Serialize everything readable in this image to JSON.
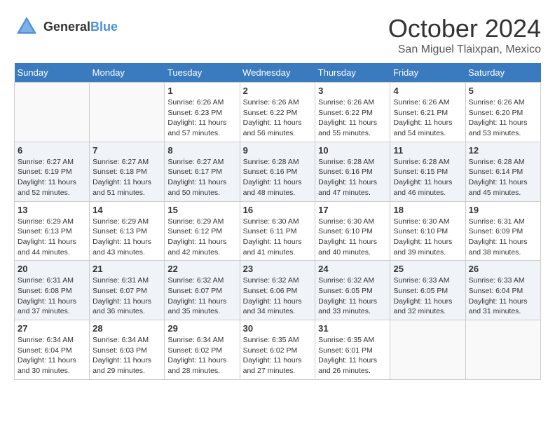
{
  "header": {
    "logo_general": "General",
    "logo_blue": "Blue",
    "month_title": "October 2024",
    "location": "San Miguel Tlaixpan, Mexico"
  },
  "calendar": {
    "days_of_week": [
      "Sunday",
      "Monday",
      "Tuesday",
      "Wednesday",
      "Thursday",
      "Friday",
      "Saturday"
    ],
    "weeks": [
      [
        {
          "day": "",
          "info": ""
        },
        {
          "day": "",
          "info": ""
        },
        {
          "day": "1",
          "info": "Sunrise: 6:26 AM\nSunset: 6:23 PM\nDaylight: 11 hours and 57 minutes."
        },
        {
          "day": "2",
          "info": "Sunrise: 6:26 AM\nSunset: 6:22 PM\nDaylight: 11 hours and 56 minutes."
        },
        {
          "day": "3",
          "info": "Sunrise: 6:26 AM\nSunset: 6:22 PM\nDaylight: 11 hours and 55 minutes."
        },
        {
          "day": "4",
          "info": "Sunrise: 6:26 AM\nSunset: 6:21 PM\nDaylight: 11 hours and 54 minutes."
        },
        {
          "day": "5",
          "info": "Sunrise: 6:26 AM\nSunset: 6:20 PM\nDaylight: 11 hours and 53 minutes."
        }
      ],
      [
        {
          "day": "6",
          "info": "Sunrise: 6:27 AM\nSunset: 6:19 PM\nDaylight: 11 hours and 52 minutes."
        },
        {
          "day": "7",
          "info": "Sunrise: 6:27 AM\nSunset: 6:18 PM\nDaylight: 11 hours and 51 minutes."
        },
        {
          "day": "8",
          "info": "Sunrise: 6:27 AM\nSunset: 6:17 PM\nDaylight: 11 hours and 50 minutes."
        },
        {
          "day": "9",
          "info": "Sunrise: 6:28 AM\nSunset: 6:16 PM\nDaylight: 11 hours and 48 minutes."
        },
        {
          "day": "10",
          "info": "Sunrise: 6:28 AM\nSunset: 6:16 PM\nDaylight: 11 hours and 47 minutes."
        },
        {
          "day": "11",
          "info": "Sunrise: 6:28 AM\nSunset: 6:15 PM\nDaylight: 11 hours and 46 minutes."
        },
        {
          "day": "12",
          "info": "Sunrise: 6:28 AM\nSunset: 6:14 PM\nDaylight: 11 hours and 45 minutes."
        }
      ],
      [
        {
          "day": "13",
          "info": "Sunrise: 6:29 AM\nSunset: 6:13 PM\nDaylight: 11 hours and 44 minutes."
        },
        {
          "day": "14",
          "info": "Sunrise: 6:29 AM\nSunset: 6:13 PM\nDaylight: 11 hours and 43 minutes."
        },
        {
          "day": "15",
          "info": "Sunrise: 6:29 AM\nSunset: 6:12 PM\nDaylight: 11 hours and 42 minutes."
        },
        {
          "day": "16",
          "info": "Sunrise: 6:30 AM\nSunset: 6:11 PM\nDaylight: 11 hours and 41 minutes."
        },
        {
          "day": "17",
          "info": "Sunrise: 6:30 AM\nSunset: 6:10 PM\nDaylight: 11 hours and 40 minutes."
        },
        {
          "day": "18",
          "info": "Sunrise: 6:30 AM\nSunset: 6:10 PM\nDaylight: 11 hours and 39 minutes."
        },
        {
          "day": "19",
          "info": "Sunrise: 6:31 AM\nSunset: 6:09 PM\nDaylight: 11 hours and 38 minutes."
        }
      ],
      [
        {
          "day": "20",
          "info": "Sunrise: 6:31 AM\nSunset: 6:08 PM\nDaylight: 11 hours and 37 minutes."
        },
        {
          "day": "21",
          "info": "Sunrise: 6:31 AM\nSunset: 6:07 PM\nDaylight: 11 hours and 36 minutes."
        },
        {
          "day": "22",
          "info": "Sunrise: 6:32 AM\nSunset: 6:07 PM\nDaylight: 11 hours and 35 minutes."
        },
        {
          "day": "23",
          "info": "Sunrise: 6:32 AM\nSunset: 6:06 PM\nDaylight: 11 hours and 34 minutes."
        },
        {
          "day": "24",
          "info": "Sunrise: 6:32 AM\nSunset: 6:05 PM\nDaylight: 11 hours and 33 minutes."
        },
        {
          "day": "25",
          "info": "Sunrise: 6:33 AM\nSunset: 6:05 PM\nDaylight: 11 hours and 32 minutes."
        },
        {
          "day": "26",
          "info": "Sunrise: 6:33 AM\nSunset: 6:04 PM\nDaylight: 11 hours and 31 minutes."
        }
      ],
      [
        {
          "day": "27",
          "info": "Sunrise: 6:34 AM\nSunset: 6:04 PM\nDaylight: 11 hours and 30 minutes."
        },
        {
          "day": "28",
          "info": "Sunrise: 6:34 AM\nSunset: 6:03 PM\nDaylight: 11 hours and 29 minutes."
        },
        {
          "day": "29",
          "info": "Sunrise: 6:34 AM\nSunset: 6:02 PM\nDaylight: 11 hours and 28 minutes."
        },
        {
          "day": "30",
          "info": "Sunrise: 6:35 AM\nSunset: 6:02 PM\nDaylight: 11 hours and 27 minutes."
        },
        {
          "day": "31",
          "info": "Sunrise: 6:35 AM\nSunset: 6:01 PM\nDaylight: 11 hours and 26 minutes."
        },
        {
          "day": "",
          "info": ""
        },
        {
          "day": "",
          "info": ""
        }
      ]
    ]
  }
}
